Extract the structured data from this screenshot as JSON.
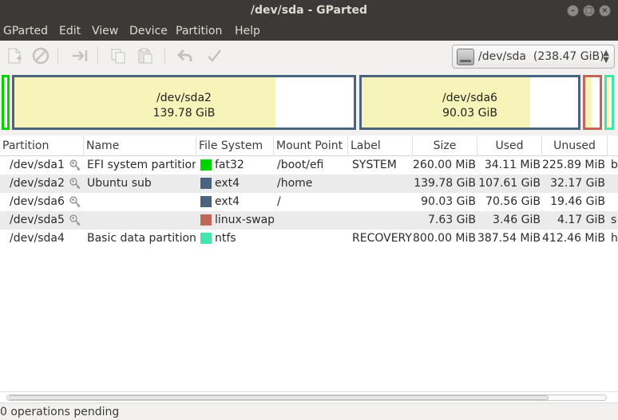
{
  "window": {
    "title": "/dev/sda - GParted"
  },
  "menu": [
    "GParted",
    "Edit",
    "View",
    "Device",
    "Partition",
    "Help"
  ],
  "toolbar": {
    "buttons": [
      "new-icon",
      "delete-icon",
      "resize-move-icon",
      "copy-icon",
      "paste-icon",
      "undo-icon",
      "apply-icon"
    ],
    "device_selector": "/dev/sda  (238.47 GiB)"
  },
  "map": {
    "sda2": {
      "name": "/dev/sda2",
      "size": "139.78 GiB",
      "used_fraction": 0.77
    },
    "sda6": {
      "name": "/dev/sda6",
      "size": "90.03 GiB",
      "used_fraction": 0.78
    },
    "colors": {
      "efi": "#00d400",
      "ext4": "#4a6480",
      "swap": "#c1665a",
      "ntfs": "#42e5ac",
      "used": "#f7f4ba"
    }
  },
  "table": {
    "headers": [
      "Partition",
      "Name",
      "File System",
      "Mount Point",
      "Label",
      "Size",
      "Used",
      "Unused",
      "Fl"
    ],
    "rows": [
      {
        "partition": "/dev/sda1",
        "name": "EFI system partition",
        "fs": "fat32",
        "fs_color": "#00d400",
        "mount": "/boot/efi",
        "label": "SYSTEM",
        "size": "260.00 MiB",
        "used": "34.11 MiB",
        "unused": "225.89 MiB",
        "flags": "b"
      },
      {
        "partition": "/dev/sda2",
        "name": "Ubuntu sub",
        "fs": "ext4",
        "fs_color": "#4a6480",
        "mount": "/home",
        "label": "",
        "size": "139.78 GiB",
        "used": "107.61 GiB",
        "unused": "32.17 GiB",
        "flags": ""
      },
      {
        "partition": "/dev/sda6",
        "name": "",
        "fs": "ext4",
        "fs_color": "#4a6480",
        "mount": "/",
        "label": "",
        "size": "90.03 GiB",
        "used": "70.56 GiB",
        "unused": "19.46 GiB",
        "flags": ""
      },
      {
        "partition": "/dev/sda5",
        "name": "",
        "fs": "linux-swap",
        "fs_color": "#c1665a",
        "mount": "",
        "label": "",
        "size": "7.63 GiB",
        "used": "3.46 GiB",
        "unused": "4.17 GiB",
        "flags": "s"
      },
      {
        "partition": "/dev/sda4",
        "name": "Basic data partition",
        "fs": "ntfs",
        "fs_color": "#42e5ac",
        "mount": "",
        "label": "RECOVERY",
        "size": "800.00 MiB",
        "used": "387.54 MiB",
        "unused": "412.46 MiB",
        "flags": "h"
      }
    ]
  },
  "status": "0 operations pending"
}
